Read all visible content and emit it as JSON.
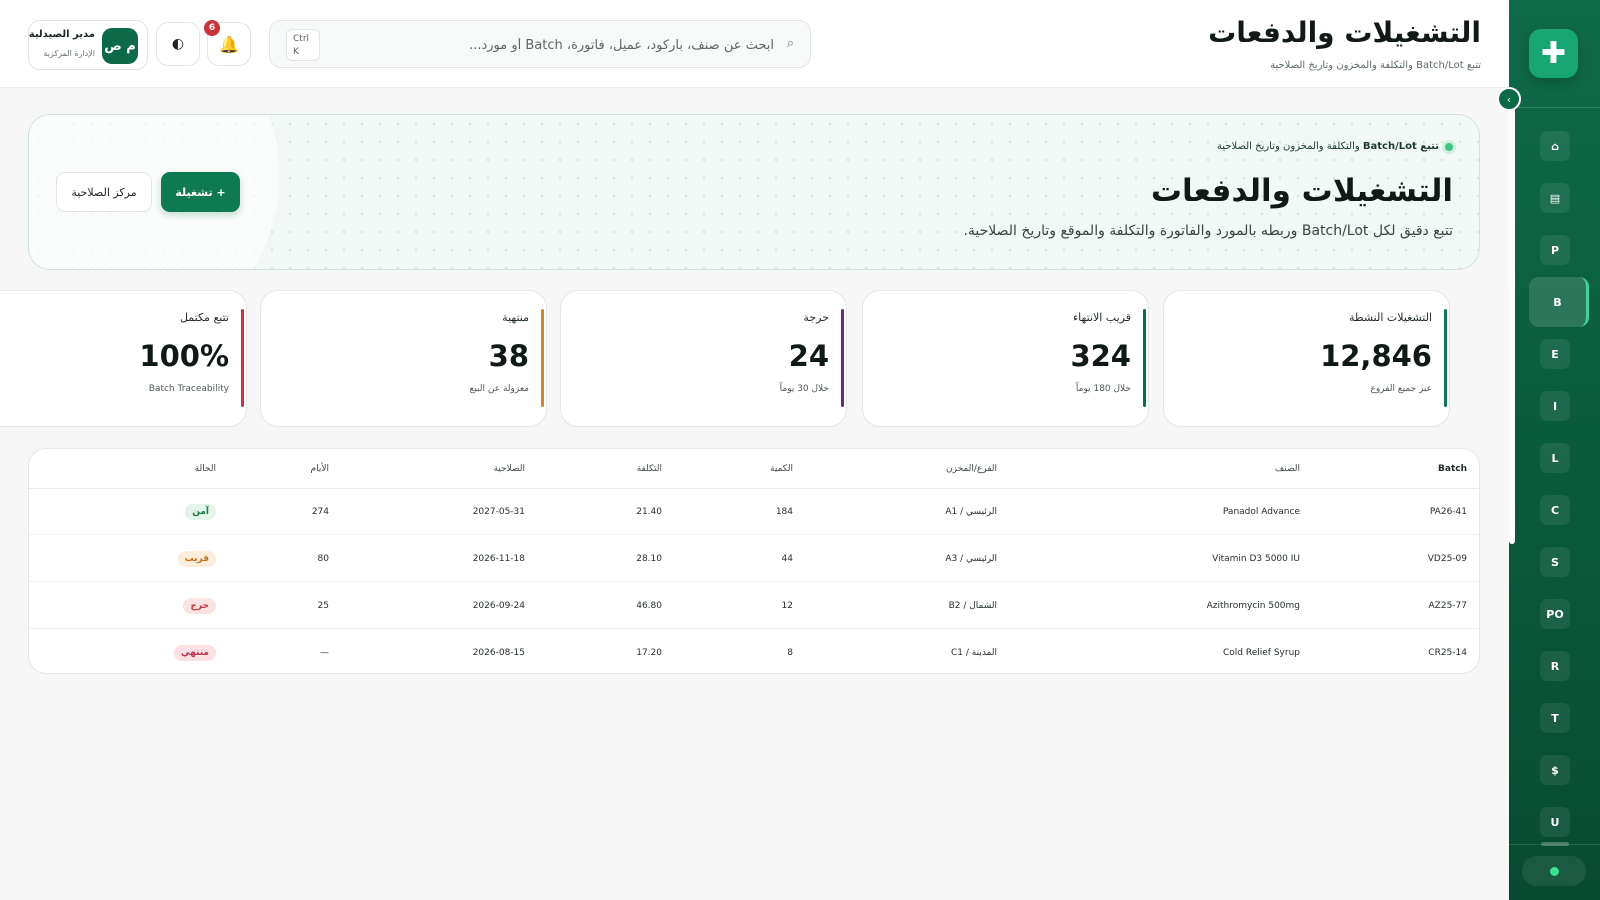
{
  "sidebar": {
    "logo": "✚",
    "items": [
      {
        "glyph": "⌂"
      },
      {
        "glyph": "▤"
      },
      {
        "glyph": "P"
      },
      {
        "glyph": "B",
        "active": true
      },
      {
        "glyph": "E"
      },
      {
        "glyph": "I"
      },
      {
        "glyph": "L"
      },
      {
        "glyph": "C"
      },
      {
        "glyph": "S"
      },
      {
        "glyph": "PO"
      },
      {
        "glyph": "R"
      },
      {
        "glyph": "T"
      },
      {
        "glyph": "$"
      },
      {
        "glyph": "U"
      }
    ]
  },
  "header": {
    "title": "التشغيلات والدفعات",
    "subtitle": "تتبع Batch/Lot والتكلفة والمخزون وتاريخ الصلاحية",
    "search_placeholder": "ابحث عن صنف، باركود، عميل، فاتورة، Batch أو مورد...",
    "shortcut_line1": "Ctrl",
    "shortcut_line2": "K",
    "notifications_count": "6",
    "user": {
      "initials": "م ص",
      "name": "مدير الصيدلية",
      "role": "الإدارة المركزية"
    }
  },
  "hero": {
    "eyebrow_bold": "تتبع Batch/Lot",
    "eyebrow_rest": " والتكلفة والمخزون وتاريخ الصلاحية",
    "title": "التشغيلات والدفعات",
    "description": "تتبع دقيق لكل Batch/Lot وربطه بالمورد والفاتورة والتكلفة والموقع وتاريخ الصلاحية.",
    "primary_button": "+ تشغيلة",
    "secondary_button": "مركز الصلاحية"
  },
  "stats": [
    {
      "label": "التشغيلات النشطة",
      "value": "12,846",
      "hint": "عبر جميع الفروع",
      "color": "#0f7a52"
    },
    {
      "label": "قريب الانتهاء",
      "value": "324",
      "hint": "خلال 180 يوماً",
      "color": "#0f6a49"
    },
    {
      "label": "حرجة",
      "value": "24",
      "hint": "خلال 30 يوماً",
      "color": "#6b2a7a"
    },
    {
      "label": "منتهية",
      "value": "38",
      "hint": "معزولة عن البيع",
      "color": "#d9821f"
    },
    {
      "label": "تتبع مكتمل",
      "value": "100%",
      "hint": "Batch Traceability",
      "color": "#c8343c"
    }
  ],
  "table": {
    "headers": {
      "batch": "Batch",
      "item": "الصنف",
      "location": "الفرع/المخزن",
      "qty": "الكمية",
      "cost": "التكلفة",
      "expiry": "الصلاحية",
      "days": "الأيام",
      "status": "الحالة"
    },
    "rows": [
      {
        "batch": "PA26-41",
        "item": "Panadol Advance",
        "location": "الرئيسي / A1",
        "qty": "184",
        "cost": "21.40",
        "expiry": "2027-05-31",
        "days": "274",
        "status": "آمن",
        "status_kind": "safe"
      },
      {
        "batch": "VD25-09",
        "item": "Vitamin D3 5000 IU",
        "location": "الرئيسي / A3",
        "qty": "44",
        "cost": "28.10",
        "expiry": "2026-11-18",
        "days": "80",
        "status": "قريب",
        "status_kind": "near"
      },
      {
        "batch": "AZ25-77",
        "item": "Azithromycin 500mg",
        "location": "الشمال / B2",
        "qty": "12",
        "cost": "46.80",
        "expiry": "2026-09-24",
        "days": "25",
        "status": "حرج",
        "status_kind": "crit"
      },
      {
        "batch": "CR25-14",
        "item": "Cold Relief Syrup",
        "location": "المدينة / C1",
        "qty": "8",
        "cost": "17.20",
        "expiry": "2026-08-15",
        "days": "—",
        "status": "منتهي",
        "status_kind": "exp"
      }
    ]
  }
}
